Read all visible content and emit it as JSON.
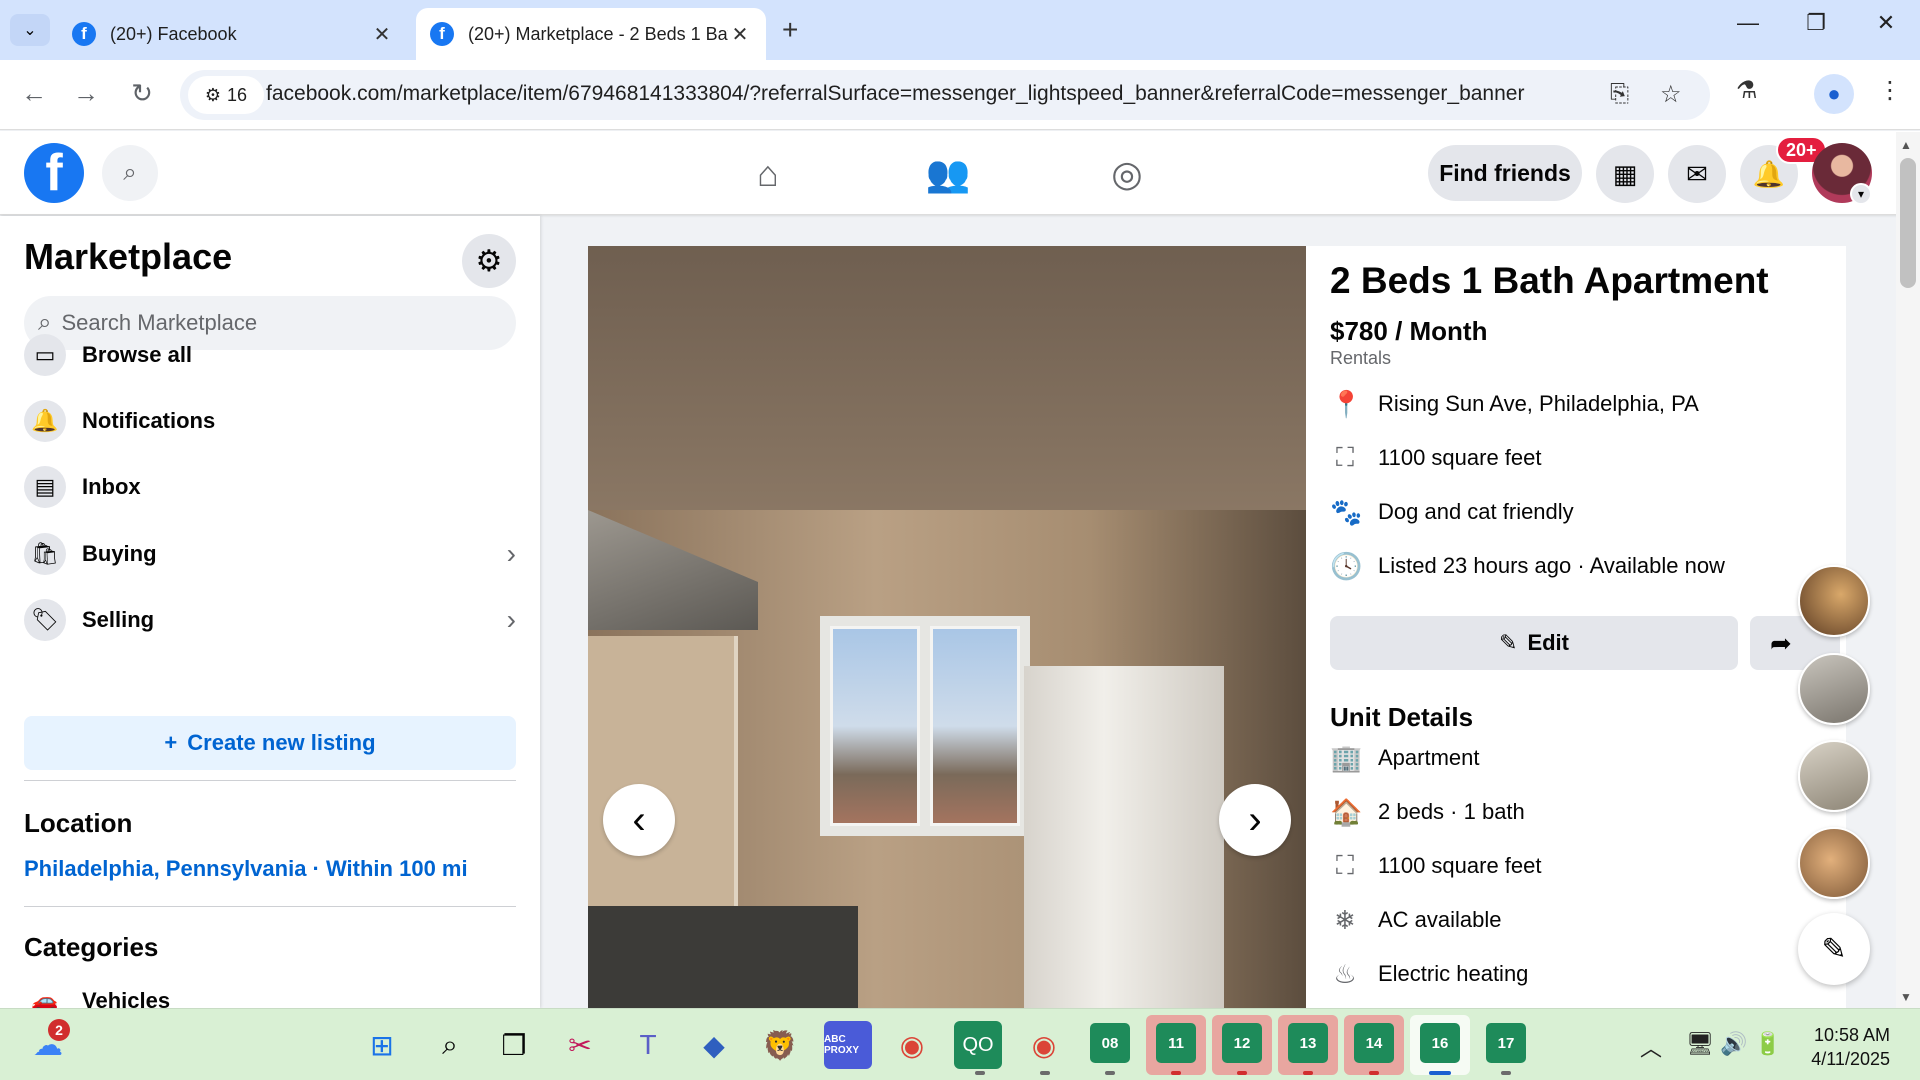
{
  "browser": {
    "tabs": [
      {
        "title": "(20+) Facebook",
        "active": false
      },
      {
        "title": "(20+) Marketplace - 2 Beds 1 Bath Apartment",
        "active": true
      }
    ],
    "url": "facebook.com/marketplace/item/679468141333804/?referralSurface=messenger_lightspeed_banner&referralCode=messenger_banner",
    "site_chip_count": "16"
  },
  "header": {
    "find_friends": "Find friends",
    "notif_badge": "20+"
  },
  "sidebar": {
    "title": "Marketplace",
    "search_placeholder": "Search Marketplace",
    "items": [
      {
        "label": "Browse all",
        "icon": "storefront-icon"
      },
      {
        "label": "Notifications",
        "icon": "bell-icon"
      },
      {
        "label": "Inbox",
        "icon": "inbox-icon"
      },
      {
        "label": "Buying",
        "icon": "shopping-bag-icon"
      },
      {
        "label": "Selling",
        "icon": "tag-icon"
      }
    ],
    "create_listing": "Create new listing",
    "location_heading": "Location",
    "location_value": "Philadelphia, Pennsylvania · Within 100 mi",
    "categories_heading": "Categories",
    "first_category": "Vehicles"
  },
  "listing": {
    "title": "2 Beds 1 Bath Apartment",
    "price": "$780 / Month",
    "category": "Rentals",
    "facts": [
      "Rising Sun Ave, Philadelphia, PA",
      "1100 square feet",
      "Dog and cat friendly",
      "Listed 23 hours ago · Available now"
    ],
    "edit_label": "Edit",
    "unit_details_heading": "Unit Details",
    "unit_details": [
      "Apartment",
      "2 beds · 1 bath",
      "1100 square feet",
      "AC available",
      "Electric heating"
    ]
  },
  "taskbar": {
    "weather_badge": "2",
    "numbered_apps": [
      "08",
      "11",
      "12",
      "13",
      "14",
      "16",
      "17"
    ],
    "proxy_label": "ABC PROXY",
    "time": "10:58 AM",
    "date": "4/11/2025"
  },
  "colors": {
    "fb_blue": "#1877f2",
    "link_blue": "#0064d1",
    "badge_red": "#e41e3f",
    "taskbar_green": "#1e8b5a"
  }
}
